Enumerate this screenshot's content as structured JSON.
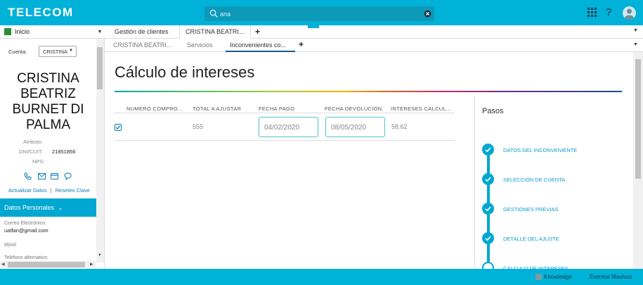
{
  "topbar": {
    "logo": "TELECOM",
    "search_value": "ana",
    "icons": [
      "search-icon",
      "clear-icon",
      "app-launcher-icon",
      "help-icon",
      "user-avatar-icon"
    ],
    "help_label": "?"
  },
  "nav": {
    "home_label": "Inicio",
    "tabs": [
      "Gestión de clientes",
      "CRISTINA BEATRI..."
    ],
    "subtabs": [
      "CRISTINA BEATRI...",
      "Servicios",
      "Inconvenientes co..."
    ],
    "plus": "+"
  },
  "left": {
    "cuenta_label": "Cuenta:",
    "cuenta_value": "CRISTINA",
    "name": "CRISTINA BEATRIZ BURNET DI PALMA",
    "atributo_label": "Atributo:",
    "dni_label": "DNI/CUIT:",
    "dni_value": "21851856",
    "nps_label": "NPS:",
    "link_update": "Actualizar Datos",
    "link_sep": "|",
    "link_reset": "Reseteo Clave",
    "section_title": "Datos Personales",
    "email_label": "Correo Electrónico:",
    "email_value": "uatfan@gmail.com",
    "movil_label": "Móvil:",
    "telefono_label": "Teléfono alternativo:"
  },
  "main": {
    "title": "Cálculo de intereses",
    "columns": [
      "NUMERO COMPRO...",
      "TOTAL A AJUSTAR",
      "FECHA PAGO",
      "FECHA DEVOLUCION",
      "INTERESES CALCUL..."
    ],
    "row": {
      "total": "555",
      "fecha_pago": "04/02/2020",
      "fecha_devolucion": "08/05/2020",
      "intereses": "58.62"
    }
  },
  "pasos": {
    "title": "Pasos",
    "steps": [
      "DATOS DEL INCONVENIENTE",
      "SELECCIÓN DE CUENTA",
      "GESTIONES PREVIAS",
      "DETALLE DEL AJUSTE",
      "CÁLCULO DE INTERESES"
    ]
  },
  "footer": {
    "knowledge": "Knowledge",
    "eventos": "Eventos Masivos"
  },
  "colors": {
    "brand": "#00b1d8",
    "accent": "#00a7d0",
    "link": "#0a7cb5"
  }
}
